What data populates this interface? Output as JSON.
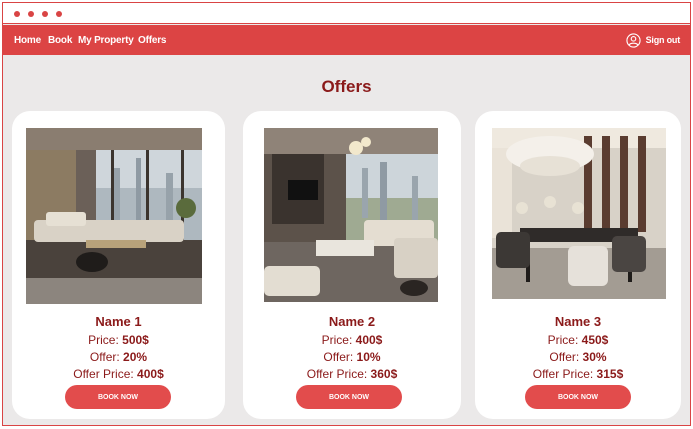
{
  "nav": {
    "links": [
      "Home",
      "Book",
      "My Property",
      "Offers"
    ],
    "signout_label": "Sign out",
    "icons": {
      "user": "user-circle-icon",
      "window_dots": "window-dots-icon"
    }
  },
  "page": {
    "title": "Offers"
  },
  "labels": {
    "price": "Price:",
    "offer": "Offer:",
    "offer_price": "Offer Price:"
  },
  "offers": [
    {
      "name": "Name 1",
      "price": "500$",
      "offer": "20%",
      "offer_price": "400$",
      "button": "BOOK NOW"
    },
    {
      "name": "Name 2",
      "price": "400$",
      "offer": "10%",
      "offer_price": "360$",
      "button": "BOOK NOW"
    },
    {
      "name": "Name 3",
      "price": "450$",
      "offer": "30%",
      "offer_price": "315$",
      "button": "BOOK NOW"
    }
  ],
  "colors": {
    "brand": "#dc4444",
    "accent_text": "#8b1a1a",
    "button": "#e24c4c",
    "page_bg": "#ebe9e9"
  }
}
